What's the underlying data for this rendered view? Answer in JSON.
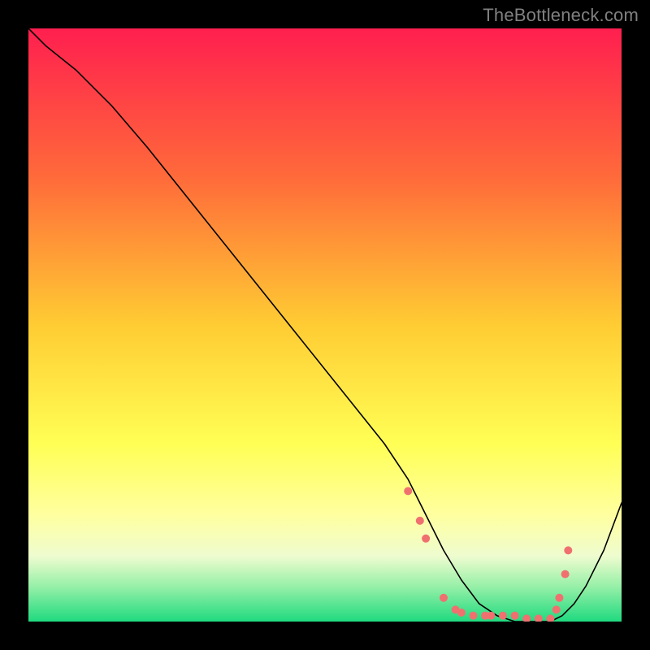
{
  "watermark": "TheBottleneck.com",
  "chart_data": {
    "type": "line",
    "title": "",
    "xlabel": "",
    "ylabel": "",
    "xlim": [
      0,
      100
    ],
    "ylim": [
      0,
      100
    ],
    "grid": false,
    "legend": false,
    "background_gradient": {
      "stops": [
        {
          "offset": 0.0,
          "color": "#ff1f4f"
        },
        {
          "offset": 0.25,
          "color": "#ff6a3a"
        },
        {
          "offset": 0.5,
          "color": "#ffcc33"
        },
        {
          "offset": 0.7,
          "color": "#ffff55"
        },
        {
          "offset": 0.82,
          "color": "#ffffa0"
        },
        {
          "offset": 0.89,
          "color": "#eefccf"
        },
        {
          "offset": 0.94,
          "color": "#98f0a8"
        },
        {
          "offset": 1.0,
          "color": "#1fda7f"
        }
      ]
    },
    "series": [
      {
        "name": "bottleneck-curve",
        "x": [
          0,
          3,
          8,
          14,
          20,
          28,
          36,
          44,
          52,
          60,
          64,
          67,
          70,
          73,
          76,
          79,
          82,
          85,
          88,
          90,
          92,
          94,
          97,
          100
        ],
        "y": [
          100,
          97,
          93,
          87,
          80,
          70,
          60,
          50,
          40,
          30,
          24,
          18,
          12,
          7,
          3,
          1,
          0,
          0,
          0,
          1,
          3,
          6,
          12,
          20
        ]
      }
    ],
    "markers": {
      "name": "highlight-dots",
      "x": [
        64,
        66,
        67,
        70,
        72,
        73,
        75,
        77,
        78,
        80,
        82,
        84,
        86,
        88,
        89,
        89.5,
        90.5,
        91
      ],
      "y": [
        22,
        17,
        14,
        4,
        2,
        1.5,
        1,
        1,
        1,
        1,
        1,
        0.5,
        0.5,
        0.5,
        2,
        4,
        8,
        12
      ]
    }
  }
}
